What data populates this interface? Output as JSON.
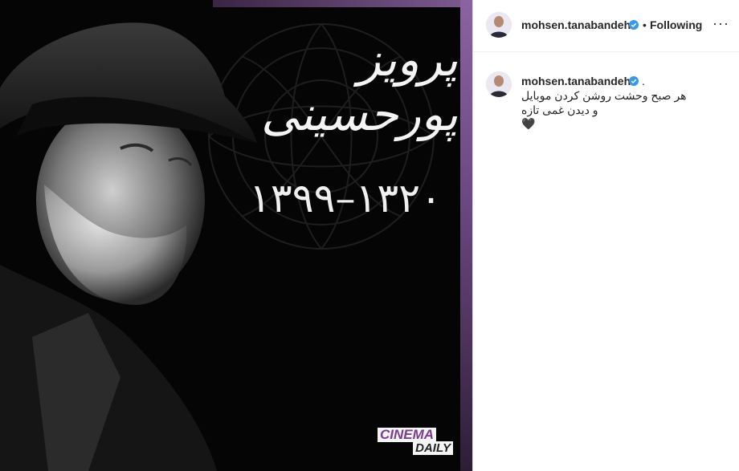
{
  "post": {
    "title_line1": "پرویز پورحسینی",
    "years": "۱۳۹۹–۱۳۲۰",
    "logo": {
      "top": "CINEMA",
      "bottom": "DAILY"
    },
    "colors": {
      "accent_purple": "#7e5a92",
      "background": "#050505"
    }
  },
  "header": {
    "username": "mohsen.tanabandeh",
    "separator": "•",
    "follow_status": "Following",
    "more_icon": "ellipsis-icon"
  },
  "caption": {
    "username": "mohsen.tanabandeh",
    "suffix": ".",
    "line1": "هر صبح وحشت روشن کردن موبایل",
    "line2": "و دیدن غمی تازه🖤"
  }
}
